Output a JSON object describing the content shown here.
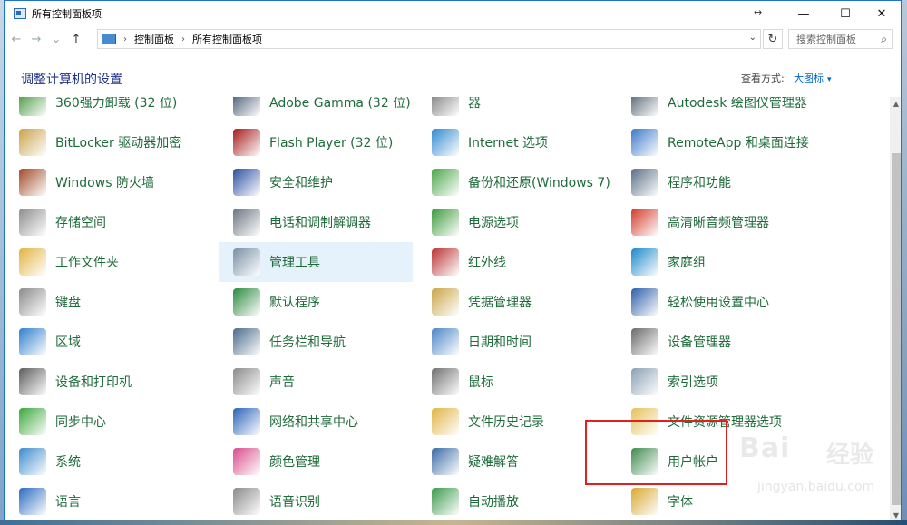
{
  "window": {
    "title": "所有控制面板项",
    "resize_glyph": "↔",
    "min_glyph": "—",
    "max_glyph": "☐",
    "close_glyph": "✕"
  },
  "nav": {
    "back_glyph": "←",
    "forward_glyph": "→",
    "history_glyph": "⌄",
    "up_glyph": "↑",
    "breadcrumb": [
      "控制面板",
      "所有控制面板项"
    ],
    "separator": "›",
    "dropdown_glyph": "⌄",
    "refresh_glyph": "↻",
    "search_placeholder": "搜索控制面板",
    "search_glyph": "⌕"
  },
  "header": {
    "title": "调整计算机的设置",
    "view_label": "查看方式:",
    "view_value": "大图标",
    "caret": "▾"
  },
  "items": [
    {
      "label": "360强力卸载 (32 位)",
      "icon": "uninstall-icon",
      "color": "#3a8f2f"
    },
    {
      "label": "Adobe Gamma (32 位)",
      "icon": "monitor-icon",
      "color": "#3d4f6b"
    },
    {
      "label": "器",
      "icon": "tool-icon",
      "color": "#777777"
    },
    {
      "label": "Autodesk 绘图仪管理器",
      "icon": "plotter-icon",
      "color": "#4a5a6a"
    },
    {
      "label": "BitLocker 驱动器加密",
      "icon": "key-icon",
      "color": "#c9a24a"
    },
    {
      "label": "Flash Player (32 位)",
      "icon": "flash-icon",
      "color": "#a51b1b"
    },
    {
      "label": "Internet 选项",
      "icon": "globe-icon",
      "color": "#2f8ad1"
    },
    {
      "label": "RemoteApp 和桌面连接",
      "icon": "remote-icon",
      "color": "#3c79c8"
    },
    {
      "label": "Windows 防火墙",
      "icon": "firewall-icon",
      "color": "#a04a28"
    },
    {
      "label": "安全和维护",
      "icon": "flag-icon",
      "color": "#2a4fa0"
    },
    {
      "label": "备份和还原(Windows 7)",
      "icon": "backup-icon",
      "color": "#4aa64a"
    },
    {
      "label": "程序和功能",
      "icon": "programs-icon",
      "color": "#5a6f86"
    },
    {
      "label": "存储空间",
      "icon": "storage-icon",
      "color": "#8c8c8c"
    },
    {
      "label": "电话和调制解调器",
      "icon": "phone-icon",
      "color": "#6b7480"
    },
    {
      "label": "电源选项",
      "icon": "power-icon",
      "color": "#3a9a3a"
    },
    {
      "label": "高清晰音频管理器",
      "icon": "audio-icon",
      "color": "#d23a2a"
    },
    {
      "label": "工作文件夹",
      "icon": "folder-icon",
      "color": "#e3b341"
    },
    {
      "label": "管理工具",
      "icon": "admin-tools-icon",
      "color": "#7a8fa6"
    },
    {
      "label": "红外线",
      "icon": "infrared-icon",
      "color": "#b33"
    },
    {
      "label": "家庭组",
      "icon": "homegroup-icon",
      "color": "#1e88c9"
    },
    {
      "label": "键盘",
      "icon": "keyboard-icon",
      "color": "#8a8a8a"
    },
    {
      "label": "默认程序",
      "icon": "default-programs-icon",
      "color": "#2b8a3e"
    },
    {
      "label": "凭据管理器",
      "icon": "credential-icon",
      "color": "#c8a545"
    },
    {
      "label": "轻松使用设置中心",
      "icon": "accessibility-icon",
      "color": "#2e5fa8"
    },
    {
      "label": "区域",
      "icon": "region-icon",
      "color": "#2f7fcc"
    },
    {
      "label": "任务栏和导航",
      "icon": "taskbar-icon",
      "color": "#4a6a8a"
    },
    {
      "label": "日期和时间",
      "icon": "calendar-icon",
      "color": "#4a86c5"
    },
    {
      "label": "设备管理器",
      "icon": "device-manager-icon",
      "color": "#6a6a6a"
    },
    {
      "label": "设备和打印机",
      "icon": "printer-icon",
      "color": "#5b5b5b"
    },
    {
      "label": "声音",
      "icon": "speaker-icon",
      "color": "#8a8a8a"
    },
    {
      "label": "鼠标",
      "icon": "mouse-icon",
      "color": "#707070"
    },
    {
      "label": "索引选项",
      "icon": "index-icon",
      "color": "#8aa0b5"
    },
    {
      "label": "同步中心",
      "icon": "sync-icon",
      "color": "#3aa63a"
    },
    {
      "label": "网络和共享中心",
      "icon": "network-icon",
      "color": "#2a62b8"
    },
    {
      "label": "文件历史记录",
      "icon": "file-history-icon",
      "color": "#e0b444"
    },
    {
      "label": "文件资源管理器选项",
      "icon": "explorer-options-icon",
      "color": "#e6c25a"
    },
    {
      "label": "系统",
      "icon": "system-icon",
      "color": "#3a8acc"
    },
    {
      "label": "颜色管理",
      "icon": "color-icon",
      "color": "#d94a8a"
    },
    {
      "label": "疑难解答",
      "icon": "troubleshoot-icon",
      "color": "#3a6aa5"
    },
    {
      "label": "用户帐户",
      "icon": "users-icon",
      "color": "#3f8a4f"
    },
    {
      "label": "语言",
      "icon": "language-icon",
      "color": "#2a6ac0"
    },
    {
      "label": "语音识别",
      "icon": "microphone-icon",
      "color": "#8a8a8a"
    },
    {
      "label": "自动播放",
      "icon": "autoplay-icon",
      "color": "#3a9a4a"
    },
    {
      "label": "字体",
      "icon": "font-icon",
      "color": "#d8a830"
    }
  ],
  "scrollbar": {
    "up_glyph": "▲",
    "down_glyph": "▼"
  },
  "watermark": {
    "logo": "Bai",
    "text": "经验",
    "url": "jingyan.baidu.com"
  }
}
